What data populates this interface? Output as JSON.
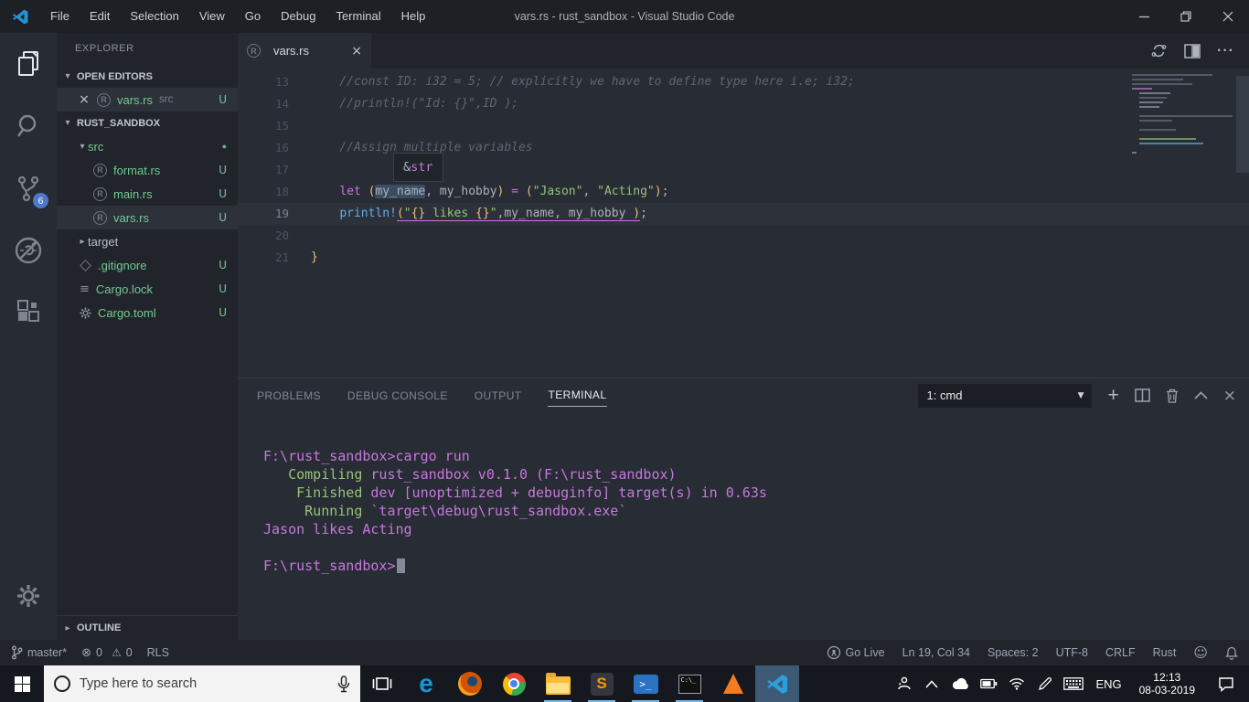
{
  "title_bar": {
    "title": "vars.rs - rust_sandbox - Visual Studio Code",
    "menus": [
      "File",
      "Edit",
      "Selection",
      "View",
      "Go",
      "Debug",
      "Terminal",
      "Help"
    ]
  },
  "activity_bar": {
    "scm_badge": "6"
  },
  "sidebar": {
    "title": "EXPLORER",
    "open_editors_label": "OPEN EDITORS",
    "open_editor": {
      "name": "vars.rs",
      "detail": "src",
      "badge": "U"
    },
    "root_label": "RUST_SANDBOX",
    "items": [
      {
        "name": "src",
        "badge": "●"
      },
      {
        "name": "format.rs",
        "badge": "U"
      },
      {
        "name": "main.rs",
        "badge": "U"
      },
      {
        "name": "vars.rs",
        "badge": "U"
      },
      {
        "name": "target",
        "badge": ""
      },
      {
        "name": ".gitignore",
        "badge": "U"
      },
      {
        "name": "Cargo.lock",
        "badge": "U"
      },
      {
        "name": "Cargo.toml",
        "badge": "U"
      }
    ],
    "outline_label": "OUTLINE"
  },
  "editor": {
    "tab": "vars.rs",
    "line_numbers": [
      "13",
      "14",
      "15",
      "16",
      "17",
      "18",
      "19",
      "20",
      "21"
    ],
    "l13": "    //const ID: i32 = 5; // explicitly we have to define type here i.e; i32;",
    "l14": "    //println!(\"Id: {}\",ID );",
    "l16": "    //Assign multiple variables",
    "l18": [
      "    ",
      "let ",
      "(",
      "my_name",
      ", my_hobby",
      ")",
      " ",
      "=",
      " ",
      "(",
      "\"Jason\"",
      ", ",
      "\"Acting\"",
      ")",
      ";"
    ],
    "l19": [
      "    ",
      "println!",
      "(",
      "\"",
      "{}",
      " likes ",
      "{}",
      "\"",
      ",my_name, my_hobby ",
      ")",
      ";"
    ],
    "l21": "}",
    "tooltip": {
      "amp": "&",
      "type": "str"
    }
  },
  "panel": {
    "tabs": [
      "PROBLEMS",
      "DEBUG CONSOLE",
      "OUTPUT",
      "TERMINAL"
    ],
    "terminal_select": "1: cmd",
    "terminal": {
      "l1": "F:\\rust_sandbox>cargo run",
      "l2a": "   Compiling",
      "l2b": " rust_sandbox v0.1.0 (F:\\rust_sandbox)",
      "l3a": "    Finished",
      "l3b": " dev [unoptimized + debuginfo] target(s) in 0.63s",
      "l4a": "     Running",
      "l4b": " `target\\debug\\rust_sandbox.exe`",
      "l5": "Jason likes Acting",
      "l7": "F:\\rust_sandbox>"
    }
  },
  "status_bar": {
    "branch": "master*",
    "errors": "0",
    "warnings": "0",
    "rls": "RLS",
    "go_live": "Go Live",
    "position": "Ln 19, Col 34",
    "indent": "Spaces: 2",
    "encoding": "UTF-8",
    "eol": "CRLF",
    "language": "Rust"
  },
  "taskbar": {
    "search_placeholder": "Type here to search",
    "language": "ENG",
    "time": "12:13",
    "date": "08-03-2019"
  },
  "colors": {
    "accent_blue": "#4d78cc",
    "untracked_green": "#73c991",
    "terminal_magenta": "#c678dd",
    "terminal_green": "#98c379"
  }
}
